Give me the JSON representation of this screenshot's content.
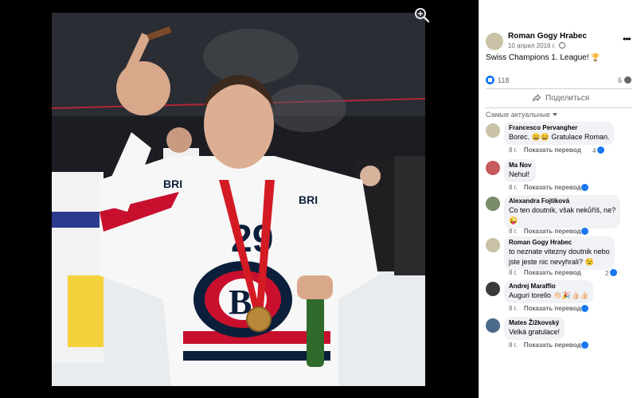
{
  "viewer": {
    "zoom_icon": "magnifier-plus-icon",
    "jersey_number": "29",
    "sponsor_text": "BRI"
  },
  "post": {
    "author": "Roman Gogy Hrabec",
    "date": "10 април 2016 г.",
    "caption": "Swiss Champions 1. League!",
    "caption_emoji": "🏆",
    "likes": "118",
    "comments": "6",
    "share_label": "Поделиться",
    "sort_label": "Самые актуальные"
  },
  "comments": [
    {
      "author": "Francesco Pervangher",
      "text": [
        "Borec. 😄😄 Gratulace Roman."
      ],
      "age": "8 г.",
      "translate": "Показать перевод",
      "reactions": "4"
    },
    {
      "author": "Ma Nov",
      "text": [
        "Nehul!"
      ],
      "age": "8 г.",
      "translate": "Показать перевод",
      "reactions": ""
    },
    {
      "author": "Alexandra Fojtíková",
      "text": [
        "Co ten doutník, však nekůříš, ne?",
        "😜"
      ],
      "age": "8 г.",
      "translate": "Показать перевод",
      "reactions": ""
    },
    {
      "author": "Roman Gogy Hrabec",
      "text": [
        "to neznate vitezny doutnik nebo",
        "jste jeste nic nevyhrali? 😉"
      ],
      "age": "8 г.",
      "translate": "Показать перевод",
      "reactions": "2"
    },
    {
      "author": "Andrej Maraffio",
      "text": [
        "Auguri torello 👏🏻🎉👍🏻👍🏻"
      ],
      "age": "8 г.",
      "translate": "Показать перевод",
      "reactions": ""
    },
    {
      "author": "Mates Žižkovský",
      "text": [
        "Velká gratulace!"
      ],
      "age": "8 г.",
      "translate": "Показать перевод",
      "reactions": ""
    }
  ],
  "colors": {
    "accent": "#1877f2",
    "muted": "#65676b",
    "bubble": "#f0f2f5",
    "viewer_bg": "#000000"
  }
}
